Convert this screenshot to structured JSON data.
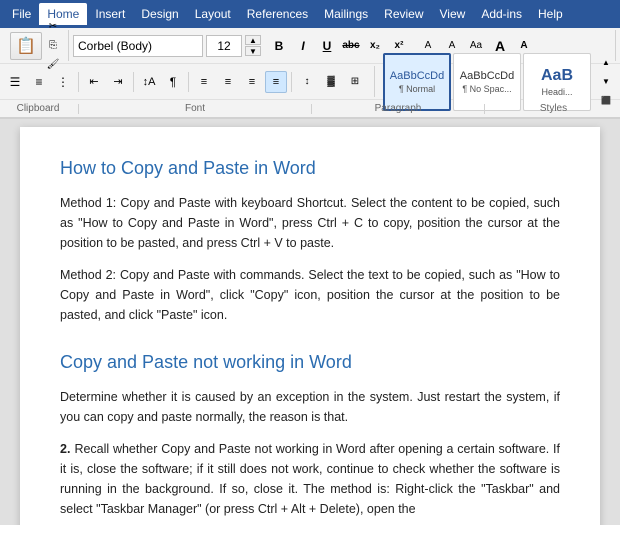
{
  "menubar": {
    "items": [
      {
        "id": "file",
        "label": "File"
      },
      {
        "id": "home",
        "label": "Home",
        "active": true
      },
      {
        "id": "insert",
        "label": "Insert"
      },
      {
        "id": "design",
        "label": "Design"
      },
      {
        "id": "layout",
        "label": "Layout"
      },
      {
        "id": "references",
        "label": "References"
      },
      {
        "id": "mailings",
        "label": "Mailings"
      },
      {
        "id": "review",
        "label": "Review"
      },
      {
        "id": "view",
        "label": "View"
      },
      {
        "id": "addins",
        "label": "Add-ins"
      },
      {
        "id": "help",
        "label": "Help"
      }
    ]
  },
  "ribbon": {
    "font_name": "Corbel (Body)",
    "font_size": "12",
    "bold": "B",
    "italic": "I",
    "underline": "U",
    "strikethrough": "abc",
    "subscript": "x₂",
    "superscript": "x²",
    "format_btns": [
      "B",
      "I",
      "U",
      "abc",
      "x₂",
      "x²"
    ],
    "labels": {
      "clipboard": "Clipboard",
      "font": "Font",
      "paragraph": "Paragraph",
      "styles": "Styles"
    },
    "styles": [
      {
        "id": "normal",
        "preview": "AaBbCcDd",
        "label": "¶ Normal",
        "active": true
      },
      {
        "id": "nospace",
        "preview": "AaBbCcDd",
        "label": "¶ No Spac...",
        "active": false
      },
      {
        "id": "heading1",
        "preview": "AaB",
        "label": "Headi...",
        "active": false
      }
    ]
  },
  "document": {
    "heading1": "How to Copy and Paste in Word",
    "para1": "Method 1: Copy and Paste with keyboard Shortcut. Select the content to be copied, such as \"How to Copy and Paste in Word\", press Ctrl + C to copy, position the cursor at the position to be pasted, and press Ctrl + V to paste.",
    "para2": "Method 2: Copy and Paste with commands. Select the text to be copied, such as \"How to Copy and Paste in Word\", click \"Copy\" icon, position the cursor at the position to be pasted, and click \"Paste\" icon.",
    "heading2": "Copy and Paste not working in Word",
    "para3": "Determine whether it is caused by an exception in the system. Just restart the system, if you can copy and paste normally, the reason is that.",
    "para4_num": "2.",
    "para4": "Recall whether Copy and Paste not working in Word after opening a certain software. If it is, close the software; if it still does not work, continue to check whether the software is running in the background. If so, close it. The method is: Right-click the \"Taskbar\" and select \"Taskbar Manager\" (or press Ctrl + Alt + Delete), open the"
  }
}
